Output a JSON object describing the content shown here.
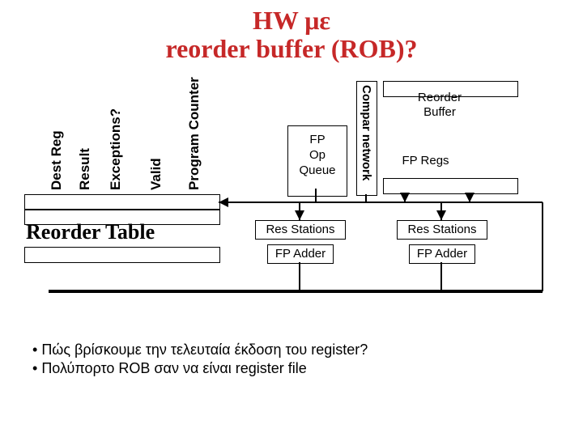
{
  "title_line1": "HW με",
  "title_line2": "reorder buffer (ROB)?",
  "columns": {
    "dest_reg": "Dest Reg",
    "result": "Result",
    "exceptions": "Exceptions?",
    "valid": "Valid",
    "program_counter": "Program Counter"
  },
  "reorder_table_label": "Reorder Table",
  "fp_op_queue": "FP\nOp\nQueue",
  "compar_network": "Compar network",
  "reorder_buffer": "Reorder\nBuffer",
  "fp_regs": "FP Regs",
  "res_stations": "Res Stations",
  "fp_adder": "FP Adder",
  "bullet1": "Πώς βρίσκουμε την τελευταία έκδοση του register?",
  "bullet2": "Πολύπορτο ROB σαν να είναι register file"
}
